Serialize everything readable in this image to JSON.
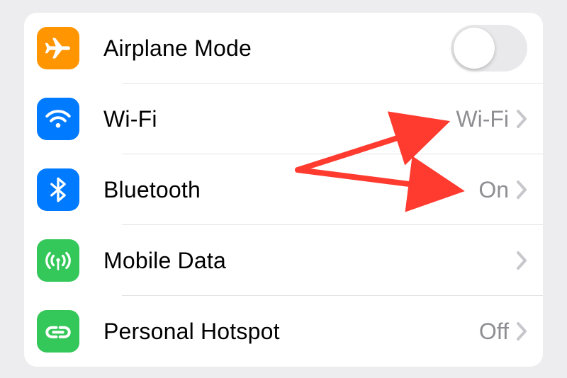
{
  "settings": {
    "rows": [
      {
        "key": "airplane",
        "label": "Airplane Mode",
        "value": "",
        "control": "toggle",
        "toggle_on": false,
        "icon": "airplane",
        "icon_bg": "orange"
      },
      {
        "key": "wifi",
        "label": "Wi-Fi",
        "value": "Wi-Fi",
        "control": "chevron",
        "icon": "wifi",
        "icon_bg": "blue"
      },
      {
        "key": "bluetooth",
        "label": "Bluetooth",
        "value": "On",
        "control": "chevron",
        "icon": "bluetooth",
        "icon_bg": "blue"
      },
      {
        "key": "mobile",
        "label": "Mobile Data",
        "value": "",
        "control": "chevron",
        "icon": "antenna",
        "icon_bg": "green"
      },
      {
        "key": "hotspot",
        "label": "Personal Hotspot",
        "value": "Off",
        "control": "chevron",
        "icon": "link",
        "icon_bg": "green"
      }
    ]
  },
  "annotation": {
    "color": "#ff3b30",
    "arrows": [
      {
        "description": "arrow to Wi-Fi value"
      },
      {
        "description": "arrow to Bluetooth value"
      }
    ]
  }
}
